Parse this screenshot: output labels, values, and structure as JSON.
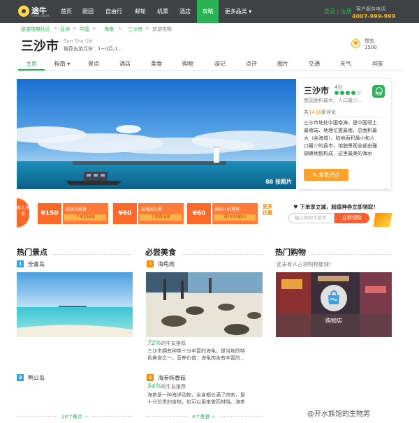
{
  "brand": {
    "name": "途牛",
    "sub": "tuniu.com"
  },
  "nav": {
    "items": [
      {
        "label": "首页"
      },
      {
        "label": "跟团"
      },
      {
        "label": "自由行"
      },
      {
        "label": "邮轮"
      },
      {
        "label": "机票"
      },
      {
        "label": "酒店"
      },
      {
        "label": "攻略"
      },
      {
        "label": "更多品类 ▾"
      }
    ],
    "login": "登录 | 注册",
    "hotline_label": "客户服务电话",
    "hotline_number": "4007-999-999"
  },
  "breadcrumb": {
    "items": [
      "旅游攻略社区",
      "亚洲",
      "中国",
      "海南",
      "三沙市",
      "旅游攻略"
    ],
    "separators": [
      ">",
      ">",
      ">",
      ">",
      ">"
    ]
  },
  "destination": {
    "name": "三沙市",
    "pinyin": "San Sha Shi",
    "season": "推荐出游月份：1~4月,1...",
    "want_label": "想去",
    "want_count": "1500"
  },
  "tabs": [
    {
      "label": "主页"
    },
    {
      "label": "指南 ▾"
    },
    {
      "label": "景点"
    },
    {
      "label": "酒店"
    },
    {
      "label": "美食"
    },
    {
      "label": "购物"
    },
    {
      "label": "游记"
    },
    {
      "label": "点评"
    },
    {
      "label": "图片"
    },
    {
      "label": "交通"
    },
    {
      "label": "天气"
    },
    {
      "label": "问答"
    }
  ],
  "hero": {
    "photo_count": "88 张照片"
  },
  "card": {
    "name": "三沙市",
    "score": "4分",
    "rating": 4,
    "badge": "地图",
    "subtitle": "我国面积最大、人口最少...",
    "reviews_prefix": "共",
    "reviews_count": "1416",
    "reviews_suffix": "条评论",
    "description": [
      "三沙市地处中国南海，是中国领土",
      "最南端、地理位置最南、总面积最",
      "大（含海域）、陆地面积最小和人",
      "口最少的县市，地貌景观全部由珊",
      "瑚礁地貌构成，这里最美的海水"
    ],
    "review_button": "发表评论"
  },
  "promo": {
    "tag": "新人专享",
    "coupons": [
      {
        "amount": "¥150",
        "title": "出境长线券",
        "note": "下单直接减"
      },
      {
        "amount": "¥60",
        "title": "出境国长券",
        "note": "下单直接减"
      },
      {
        "amount": "¥60",
        "title": "国际+机票券",
        "note": "满1000减60"
      }
    ],
    "more": "更多优惠",
    "tip": "♥ 下单享立减，超值神券立即领取！",
    "phone_placeholder": "输入你的手机号",
    "claim_button": "立即领取"
  },
  "sections": {
    "attractions": {
      "title": "热门景点",
      "items": [
        {
          "rank": "1",
          "name": "全富岛"
        },
        {
          "rank": "2",
          "name": "鸭公岛"
        }
      ],
      "count_link": "20个景点 ››"
    },
    "food": {
      "title": "必尝美食",
      "items": [
        {
          "rank": "1",
          "name": "海龟肉",
          "percent": "72%",
          "rec_label": "的牛友推荐",
          "snippet": [
            "三沙市拥有种类十分丰富的海龟，是当地的特",
            "色美食之一。营养价值：海龟肉含有丰富的..."
          ]
        },
        {
          "rank": "2",
          "name": "海参炖香菇",
          "percent": "54%",
          "rec_label": "的牛友推荐",
          "snippet": [
            "海参是一种海洋动物，全身都长满了肉刺，是",
            "十分珍贵的食物，也可以用来做药材哦。海参"
          ]
        }
      ],
      "count_link": "4个美食 ››"
    },
    "shopping": {
      "title": "热门购物",
      "empty_text": "还未有人占领购物星球！",
      "shop_label": "购物店"
    }
  },
  "watermark": "@开水族馆的生物男",
  "colors": {
    "nav_bg": "#3f4346",
    "accent_green": "#2bb256",
    "promo_orange": "#ff6a2b",
    "rank_orange": "#ff8a00",
    "rank_blue": "#3aa0e8"
  }
}
